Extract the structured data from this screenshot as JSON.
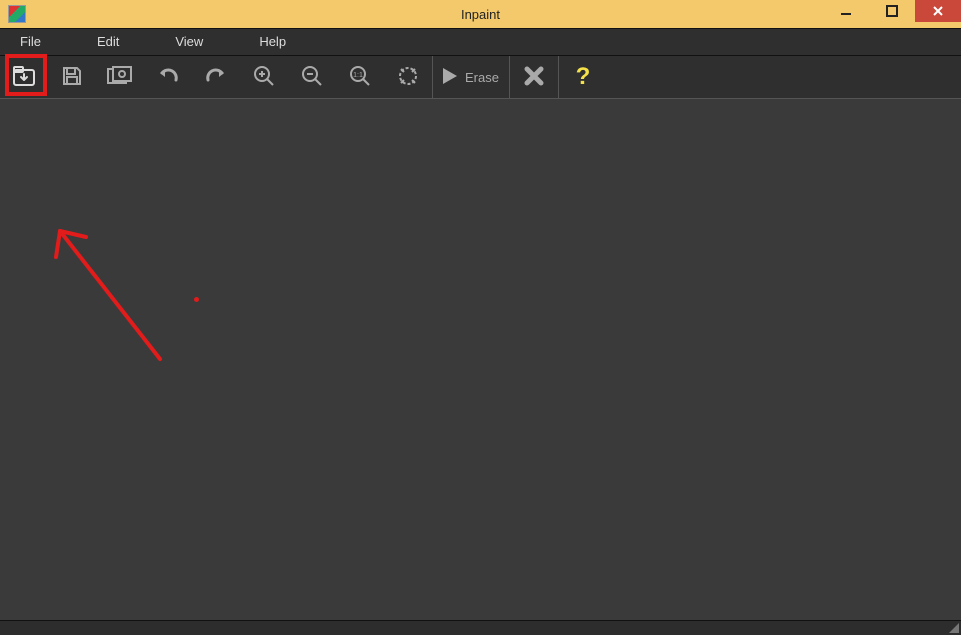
{
  "window": {
    "title": "Inpaint"
  },
  "menubar": {
    "items": [
      "File",
      "Edit",
      "View",
      "Help"
    ]
  },
  "toolbar": {
    "open_icon": "open-file-icon",
    "save_icon": "save-icon",
    "preview_icon": "preview-icon",
    "undo_icon": "undo-icon",
    "redo_icon": "redo-icon",
    "zoom_in_icon": "zoom-in-icon",
    "zoom_out_icon": "zoom-out-icon",
    "zoom_actual_icon": "zoom-actual-icon",
    "zoom_fit_icon": "zoom-fit-icon",
    "erase_label": "Erase",
    "cancel_icon": "cancel-icon",
    "help_icon": "help-icon"
  },
  "annotations": {
    "highlight_target": "open-file-button",
    "arrow_color": "#e21b1b"
  }
}
